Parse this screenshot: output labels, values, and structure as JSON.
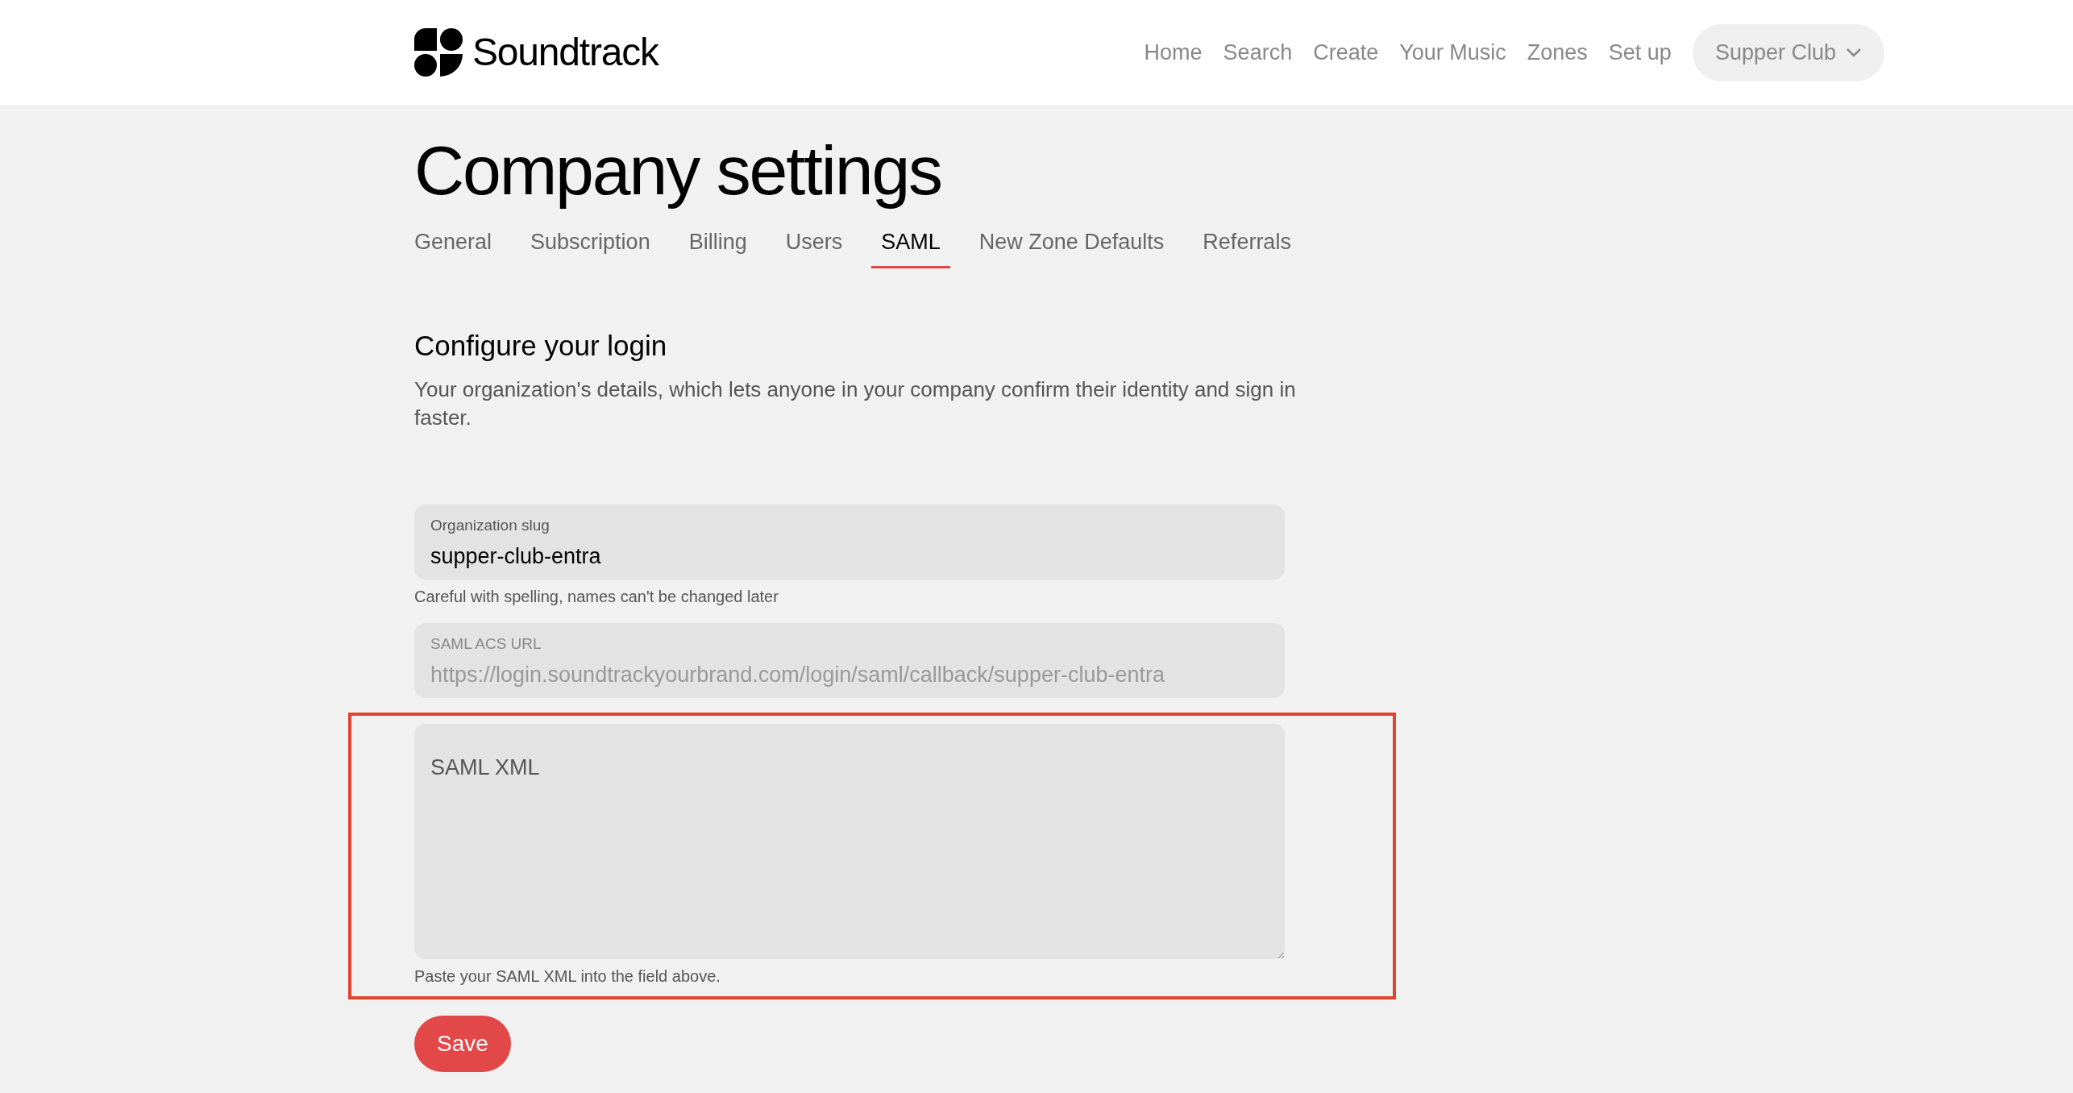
{
  "header": {
    "logo_text": "Soundtrack",
    "nav": [
      {
        "label": "Home"
      },
      {
        "label": "Search"
      },
      {
        "label": "Create"
      },
      {
        "label": "Your Music"
      },
      {
        "label": "Zones"
      },
      {
        "label": "Set up"
      }
    ],
    "account": "Supper Club"
  },
  "title": "Company settings",
  "tabs": [
    {
      "label": "General",
      "selected": false
    },
    {
      "label": "Subscription",
      "selected": false
    },
    {
      "label": "Billing",
      "selected": false
    },
    {
      "label": "Users",
      "selected": false
    },
    {
      "label": "SAML",
      "selected": true
    },
    {
      "label": "New Zone Defaults",
      "selected": false
    },
    {
      "label": "Referrals",
      "selected": false
    }
  ],
  "section": {
    "heading": "Configure your login",
    "description": "Your organization's details, which lets anyone in your company confirm their identity and sign in faster."
  },
  "fields": [
    {
      "kind": "input",
      "label": "Organization slug",
      "value": "supper-club-entra",
      "disabled": false,
      "helper": "Careful with spelling, names can't be changed later",
      "highlighted": false
    },
    {
      "kind": "input",
      "label": "SAML ACS URL",
      "value": "https://login.soundtrackyourbrand.com/login/saml/callback/supper-club-entra",
      "disabled": true,
      "highlighted": false
    },
    {
      "kind": "textarea",
      "placeholder": "SAML XML",
      "helper": "Paste your SAML XML into the field above.",
      "highlighted": true
    }
  ],
  "save_button": "Save"
}
